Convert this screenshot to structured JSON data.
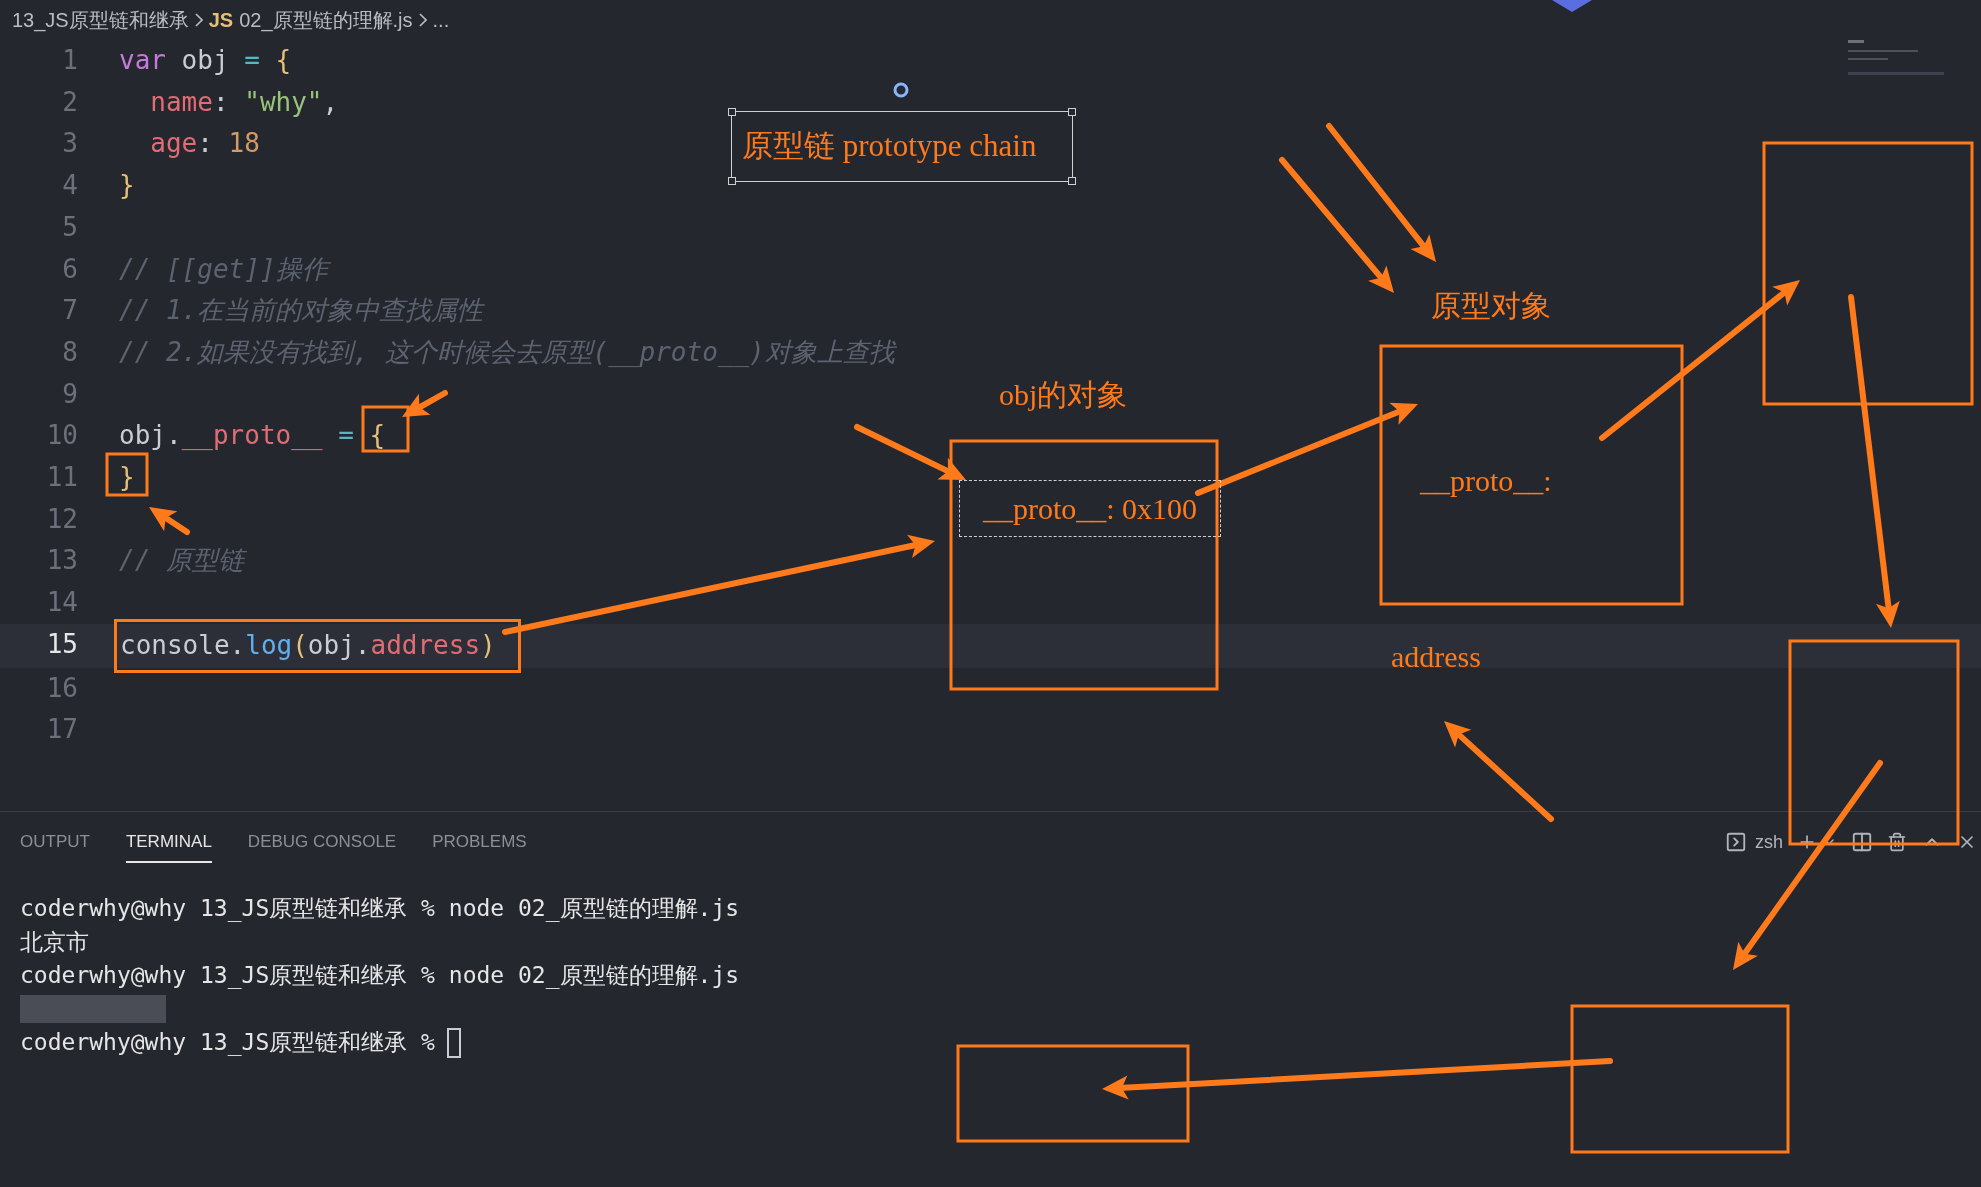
{
  "breadcrumb": {
    "folder": "13_JS原型链和继承",
    "file_icon": "JS",
    "file": "02_原型链的理解.js",
    "more": "..."
  },
  "editor": {
    "lines": [
      {
        "number": "1",
        "current": false,
        "tokens": [
          {
            "kind": "keyword",
            "text": "var"
          },
          {
            "kind": "plain",
            "text": " obj "
          },
          {
            "kind": "operator",
            "text": "="
          },
          {
            "kind": "brace",
            "text": " {"
          }
        ]
      },
      {
        "number": "2",
        "current": false,
        "tokens": [
          {
            "kind": "property",
            "text": "  name"
          },
          {
            "kind": "plain",
            "text": ": "
          },
          {
            "kind": "string",
            "text": "\"why\""
          },
          {
            "kind": "plain",
            "text": ","
          }
        ]
      },
      {
        "number": "3",
        "current": false,
        "tokens": [
          {
            "kind": "property",
            "text": "  age"
          },
          {
            "kind": "plain",
            "text": ": "
          },
          {
            "kind": "number",
            "text": "18"
          }
        ]
      },
      {
        "number": "4",
        "current": false,
        "tokens": [
          {
            "kind": "brace",
            "text": "}"
          }
        ]
      },
      {
        "number": "5",
        "current": false
      },
      {
        "number": "6",
        "current": false,
        "tokens": [
          {
            "kind": "comment",
            "text": "// [[get]]操作"
          }
        ]
      },
      {
        "number": "7",
        "current": false,
        "tokens": [
          {
            "kind": "comment",
            "text": "// 1.在当前的对象中查找属性"
          }
        ]
      },
      {
        "number": "8",
        "current": false,
        "tokens": [
          {
            "kind": "comment",
            "text": "// 2.如果没有找到, 这个时候会去原型(__proto__)对象上查找"
          }
        ]
      },
      {
        "number": "9",
        "current": false
      },
      {
        "number": "10",
        "current": false,
        "tokens": [
          {
            "kind": "plain",
            "text": "obj."
          },
          {
            "kind": "property",
            "text": "__proto__"
          },
          {
            "kind": "operator",
            "text": " = "
          },
          {
            "kind": "brace",
            "text": "{"
          }
        ]
      },
      {
        "number": "11",
        "current": false,
        "tokens": [
          {
            "kind": "brace",
            "text": "}"
          }
        ]
      },
      {
        "number": "12",
        "current": false
      },
      {
        "number": "13",
        "current": false,
        "tokens": [
          {
            "kind": "comment",
            "text": "// 原型链"
          }
        ]
      },
      {
        "number": "14",
        "current": false
      },
      {
        "number": "15",
        "current": true,
        "boxed": true,
        "tokens": [
          {
            "kind": "plain",
            "text": "console."
          },
          {
            "kind": "function",
            "text": "log"
          },
          {
            "kind": "brace",
            "text": "("
          },
          {
            "kind": "plain",
            "text": "obj."
          },
          {
            "kind": "property",
            "text": "address"
          },
          {
            "kind": "brace",
            "text": ")"
          }
        ]
      },
      {
        "number": "16",
        "current": false
      },
      {
        "number": "17",
        "current": false
      }
    ]
  },
  "annotations": {
    "title": "原型链 prototype chain",
    "proto_field": "__proto__: 0x100",
    "labels": [
      "obj的对象",
      "原型对象",
      "__proto__:",
      "address"
    ]
  },
  "panel": {
    "tabs": [
      {
        "label": "OUTPUT",
        "selected": false
      },
      {
        "label": "TERMINAL",
        "selected": true
      },
      {
        "label": "DEBUG CONSOLE",
        "selected": false
      },
      {
        "label": "PROBLEMS",
        "selected": false
      }
    ],
    "shell": "zsh"
  },
  "terminal": [
    {
      "kind": "text",
      "text": "coderwhy@why 13_JS原型链和继承 % node 02_原型链的理解.js"
    },
    {
      "kind": "text",
      "text": "北京市"
    },
    {
      "kind": "text",
      "text": "coderwhy@why 13_JS原型链和继承 % node 02_原型链的理解.js"
    },
    {
      "kind": "redacted"
    },
    {
      "kind": "prompt",
      "text": "coderwhy@why 13_JS原型链和继承 %"
    }
  ]
}
